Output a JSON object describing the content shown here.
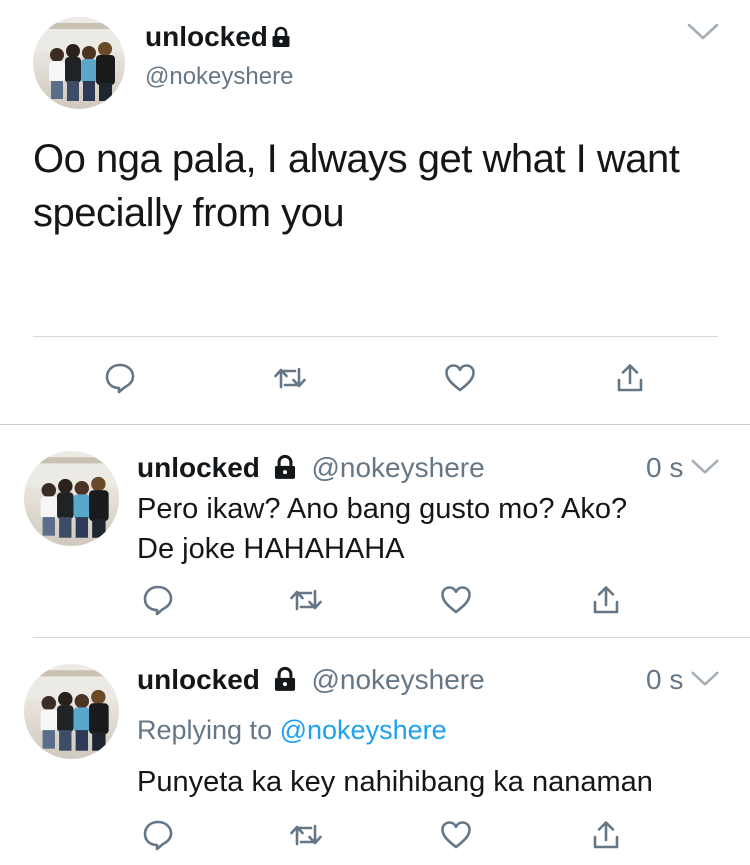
{
  "colors": {
    "text": "#14171a",
    "muted": "#657786",
    "link": "#1da1f2",
    "divider": "#d6d9dc",
    "icon": "#657786"
  },
  "main_tweet": {
    "display_name": "unlocked",
    "handle": "@nokeyshere",
    "text_line1": "Oo nga pala, I always get what I want",
    "text_line2": "specially from you"
  },
  "replies": [
    {
      "display_name": "unlocked",
      "handle": "@nokeyshere",
      "time": "0 s",
      "text_line1": "Pero ikaw? Ano bang gusto mo? Ako?",
      "text_line2": "De joke HAHAHAHA"
    },
    {
      "display_name": "unlocked",
      "handle": "@nokeyshere",
      "time": "0 s",
      "replying_label": "Replying to",
      "replying_handle": "@nokeyshere",
      "text_line1": "Punyeta ka key nahihibang ka nanaman"
    }
  ],
  "icons": {
    "reply": "reply-icon",
    "retweet": "retweet-icon",
    "like": "heart-icon",
    "share": "share-icon",
    "lock": "lock-icon",
    "chevron": "chevron-down-icon"
  }
}
